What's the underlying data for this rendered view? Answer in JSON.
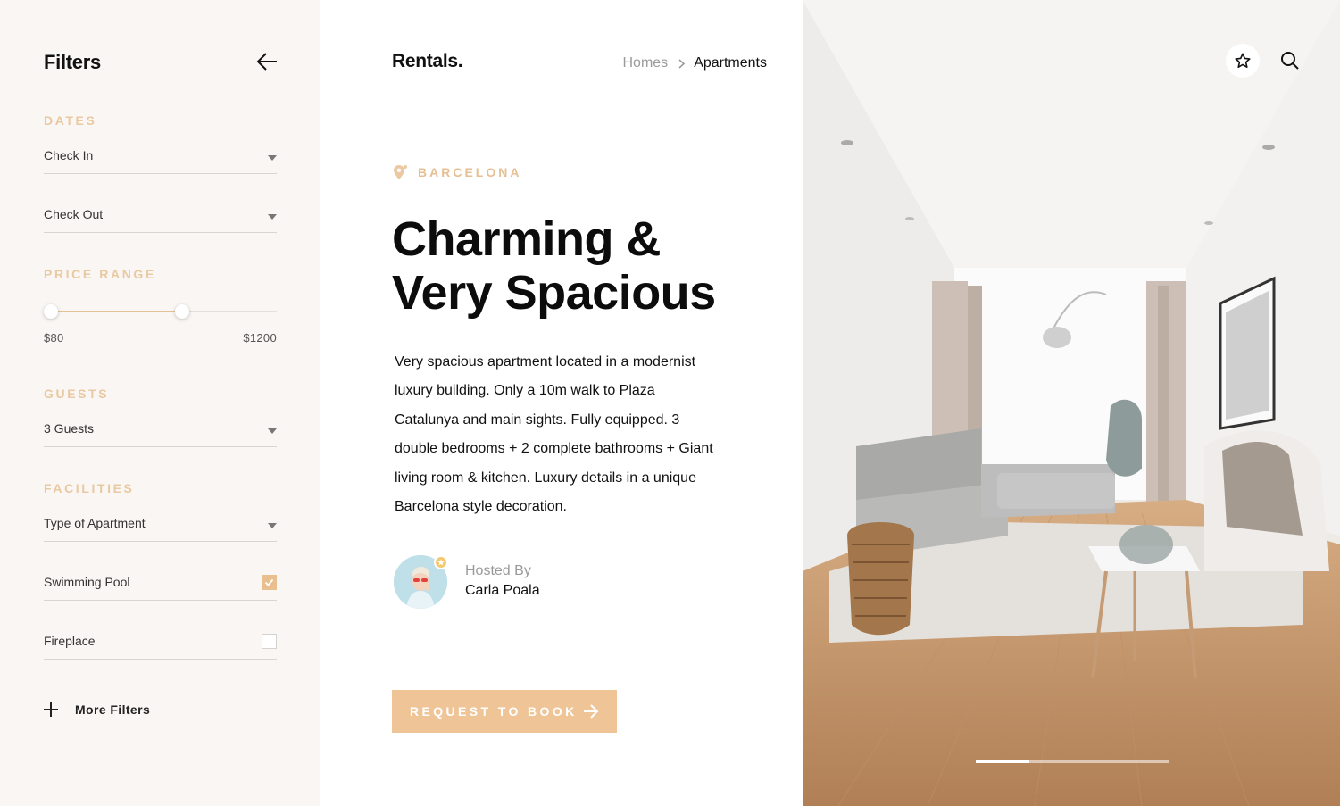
{
  "sidebar": {
    "title": "Filters",
    "back_icon": "arrow-left-icon",
    "dates": {
      "section": "DATES",
      "check_in": "Check In",
      "check_out": "Check Out"
    },
    "price": {
      "section": "PRICE RANGE",
      "min_label": "$80",
      "max_label": "$1200",
      "selected_range_fraction": [
        0.0,
        0.58
      ]
    },
    "guests": {
      "section": "GUESTS",
      "value": "3 Guests"
    },
    "facilities": {
      "section": "FACILITIES",
      "type": "Type of Apartment",
      "pool": "Swimming Pool",
      "pool_checked": true,
      "fireplace": "Fireplace",
      "fireplace_checked": false
    },
    "more_filters": "More Filters"
  },
  "header": {
    "brand": "Rentals.",
    "breadcrumb": {
      "home": "Homes",
      "current": "Apartments"
    }
  },
  "listing": {
    "location": "BARCELONA",
    "title_line1": "Charming &",
    "title_line2": "Very Spacious",
    "description": "Very spacious apartment located in a modernist luxury building. Only a 10m walk to Plaza Catalunya and main sights. Fully equipped. 3 double bedrooms + 2 complete bathrooms + Giant living room & kitchen. Luxury details in a unique Barcelona style decoration.",
    "host_label": "Hosted By",
    "host_name": "Carla Poala",
    "cta": "REQUEST TO BOOK"
  },
  "gallery": {
    "fav_icon": "star-icon",
    "search_icon": "search-icon",
    "slide_progress": 0.28
  },
  "colors": {
    "accent": "#efc598",
    "section_label": "#e9c9a2",
    "sidebar_bg": "#f9f6f3"
  }
}
